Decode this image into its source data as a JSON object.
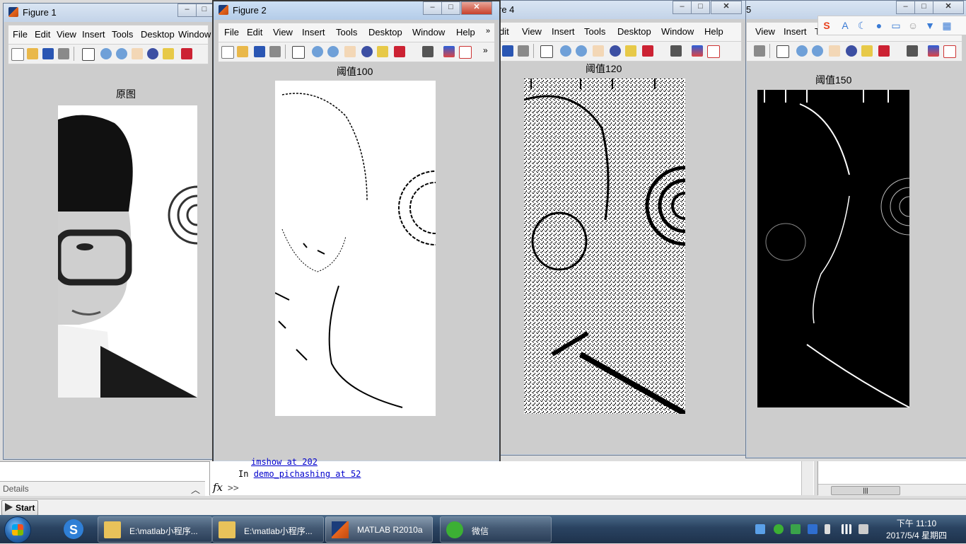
{
  "figures": [
    {
      "id": "fig1",
      "title": "Figure 1",
      "menus": [
        "File",
        "Edit",
        "View",
        "Insert",
        "Tools",
        "Desktop",
        "Window"
      ],
      "axes_title": "原图"
    },
    {
      "id": "fig2",
      "title": "Figure 2",
      "menus": [
        "File",
        "Edit",
        "View",
        "Insert",
        "Tools",
        "Desktop",
        "Window",
        "Help"
      ],
      "axes_title": "阈值100"
    },
    {
      "id": "fig4",
      "title": "re 4",
      "menus": [
        "dit",
        "View",
        "Insert",
        "Tools",
        "Desktop",
        "Window",
        "Help"
      ],
      "axes_title": "阈值120"
    },
    {
      "id": "fig5",
      "title": "5",
      "menus": [
        "View",
        "Insert",
        "T"
      ],
      "axes_title": "阈值150"
    }
  ],
  "window_buttons": {
    "minimize": "–",
    "maximize": "□",
    "close": "✕"
  },
  "toolbar_icons": [
    "new-figure-icon",
    "open-file-icon",
    "save-icon",
    "print-icon",
    "select-arrow-icon",
    "zoom-in-icon",
    "zoom-out-icon",
    "pan-hand-icon",
    "rotate-3d-icon",
    "data-cursor-icon",
    "brush-icon",
    "link-plot-icon",
    "colorbar-icon",
    "legend-icon"
  ],
  "matlab": {
    "details_label": "Details",
    "command_partial": "imshow at 202",
    "command_line_prefix": "In ",
    "command_link": "demo_pichashing at 52",
    "prompt_symbol": "fx",
    "prompt": ">>",
    "start_label": "Start",
    "scroll_thumb": "|||"
  },
  "ime_toolbar": {
    "icons": [
      "sogou-s-icon",
      "font-a-icon",
      "moon-icon",
      "microphone-icon",
      "keyboard-icon",
      "user-icon",
      "shirt-icon",
      "grid-icon"
    ]
  },
  "taskbar": {
    "tasks": [
      {
        "label": "E:\\matlab小程序...",
        "icon": "folder-icon"
      },
      {
        "label": "E:\\matlab小程序...",
        "icon": "folder-icon"
      },
      {
        "label": "MATLAB R2010a",
        "icon": "matlab-icon"
      },
      {
        "label": "微信",
        "icon": "wechat-icon"
      }
    ],
    "clock_time": "下午 11:10",
    "clock_date": "2017/5/4 星期四"
  },
  "colors": {
    "title_active": "#b4cce8",
    "title_inactive": "#c3d3e8",
    "close_red": "#c7402b",
    "taskbar": "#2a4361",
    "figure_bg": "#cdcdcd"
  }
}
